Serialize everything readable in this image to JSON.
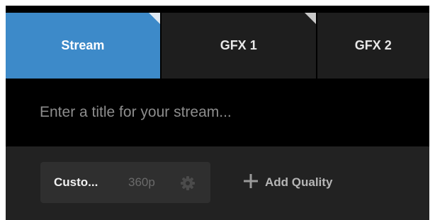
{
  "tabs": [
    {
      "label": "Stream",
      "active": true
    },
    {
      "label": "GFX 1",
      "active": false
    },
    {
      "label": "GFX 2",
      "active": false
    }
  ],
  "title_input": {
    "value": "",
    "placeholder": "Enter a title for your stream..."
  },
  "quality": {
    "name": "Custo...",
    "resolution": "360p",
    "settings_icon": "gear-icon"
  },
  "add_quality": {
    "label": "Add Quality",
    "icon": "plus-icon"
  },
  "colors": {
    "accent": "#3d8ac9",
    "tab_background": "#1e1e1e",
    "panel_background": "#222222"
  }
}
